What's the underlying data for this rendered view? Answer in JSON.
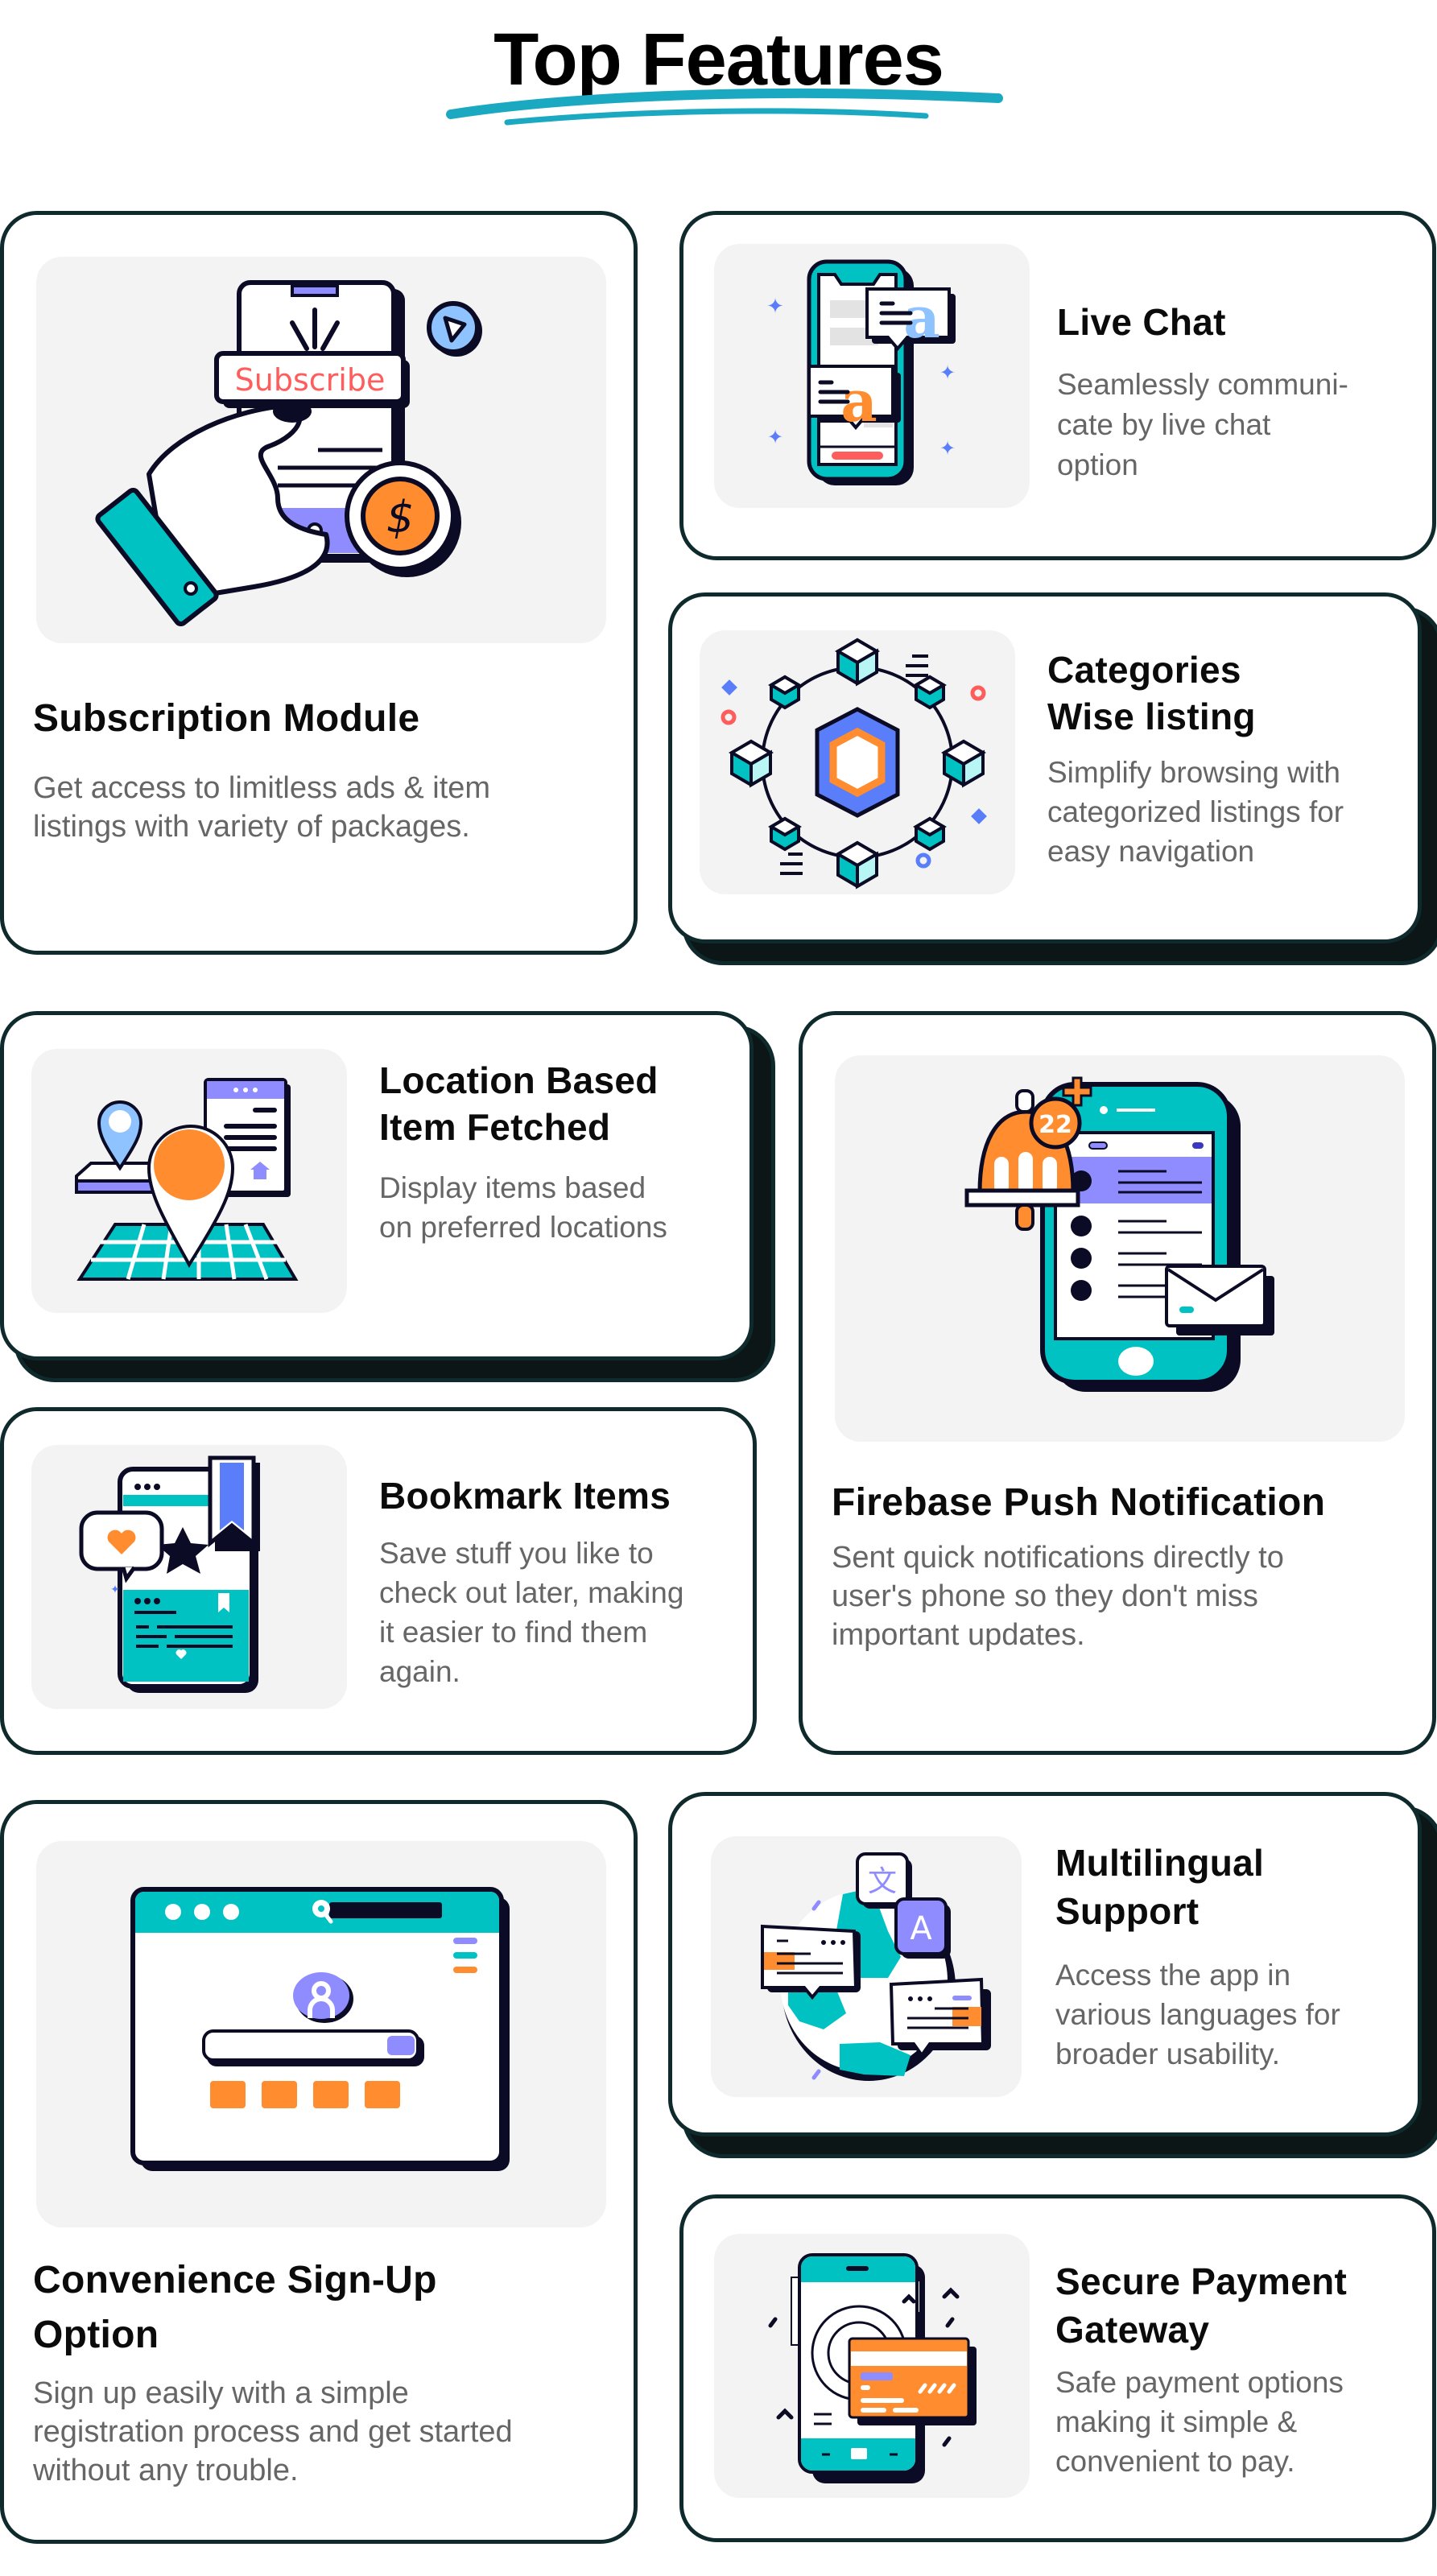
{
  "page": {
    "title": "Top Features",
    "accent_colors": {
      "teal": "#00c2c2",
      "brush_teal": "#1aa9c0",
      "orange": "#ff8c2e",
      "purple": "#8f8cff",
      "blue": "#5a7dfa",
      "light_blue": "#8fc3ff",
      "red": "#ff5c5c",
      "ink": "#0b0b25",
      "card_border": "#0f2a2c",
      "panel_bg": "#f3f3f3",
      "desc_gray": "#666666"
    }
  },
  "features": {
    "subscription": {
      "title": "Subscription Module",
      "description_lines": [
        "Get access to limitless ads & item",
        "listings with variety of packages."
      ],
      "illustration_text": "Subscribe",
      "icon": "subscribe-phone-illustration"
    },
    "live_chat": {
      "title": "Live Chat",
      "description_lines": [
        "Seamlessly communi-",
        "cate by live chat",
        "option"
      ],
      "icon": "chat-phone-illustration"
    },
    "categories": {
      "title_lines": [
        "Categories",
        "Wise listing"
      ],
      "description_lines": [
        "Simplify browsing with",
        "categorized listings for",
        "easy navigation"
      ],
      "icon": "category-network-illustration"
    },
    "location": {
      "title_lines": [
        "Location Based",
        "Item Fetched"
      ],
      "description_lines": [
        "Display items based",
        "on preferred locations"
      ],
      "icon": "location-map-illustration"
    },
    "firebase": {
      "title": "Firebase Push Notification",
      "description_lines": [
        "Sent quick notifications directly to",
        "user's phone so they don't miss",
        "important updates."
      ],
      "badge_count": "22",
      "icon": "notification-phone-illustration"
    },
    "bookmark": {
      "title": "Bookmark Items",
      "description_lines": [
        "Save stuff you like to",
        "check out later, making",
        "it easier to find them",
        "again."
      ],
      "icon": "bookmark-phone-illustration"
    },
    "signup": {
      "title_lines": [
        "Convenience Sign-Up",
        "Option"
      ],
      "description_lines": [
        "Sign up easily with a simple",
        "registration process and get started",
        "without any trouble."
      ],
      "icon": "signup-browser-illustration"
    },
    "multilingual": {
      "title_lines": [
        "Multilingual",
        "Support"
      ],
      "description_lines": [
        "Access the app in",
        "various languages for",
        "broader usability."
      ],
      "glyphs": [
        "文",
        "A"
      ],
      "icon": "globe-translate-illustration"
    },
    "payment": {
      "title_lines": [
        "Secure Payment",
        "Gateway"
      ],
      "description_lines": [
        "Safe payment options",
        "making it simple &",
        "convenient to pay."
      ],
      "icon": "payment-card-illustration"
    }
  }
}
